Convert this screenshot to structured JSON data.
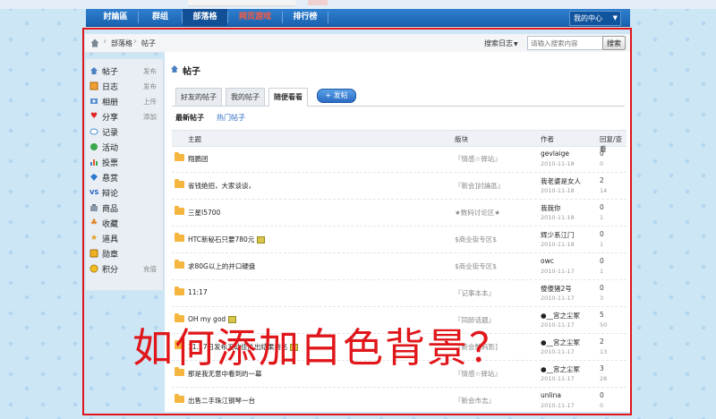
{
  "nav": {
    "items": [
      "討論區",
      "群组",
      "部落格",
      "网页游戏",
      "排行榜"
    ],
    "user_center": "我的中心"
  },
  "breadcrumb": {
    "items": [
      "部落格",
      "帖子"
    ]
  },
  "search": {
    "label": "搜索日志",
    "placeholder": "请输入搜索内容",
    "button": "搜索"
  },
  "sidebar": {
    "items": [
      {
        "label": "帖子",
        "action": "发布",
        "icon": "post-icon"
      },
      {
        "label": "日志",
        "action": "发布",
        "icon": "journal-icon"
      },
      {
        "label": "相册",
        "action": "上传",
        "icon": "album-icon"
      },
      {
        "label": "分享",
        "action": "添加",
        "icon": "heart-icon"
      },
      {
        "label": "记录",
        "action": "",
        "icon": "record-icon"
      },
      {
        "label": "活动",
        "action": "",
        "icon": "activity-icon"
      },
      {
        "label": "投票",
        "action": "",
        "icon": "poll-icon"
      },
      {
        "label": "悬赏",
        "action": "",
        "icon": "reward-icon"
      },
      {
        "label": "辩论",
        "action": "",
        "icon": "debate-icon"
      },
      {
        "label": "商品",
        "action": "",
        "icon": "goods-icon"
      },
      {
        "label": "收藏",
        "action": "",
        "icon": "favorite-icon"
      },
      {
        "label": "道具",
        "action": "",
        "icon": "item-icon"
      },
      {
        "label": "勋章",
        "action": "",
        "icon": "medal-icon"
      },
      {
        "label": "积分",
        "action": "充值",
        "icon": "points-icon"
      }
    ]
  },
  "main": {
    "title": "帖子",
    "tabs": [
      "好友的帖子",
      "我的帖子",
      "随便看看"
    ],
    "post_button": "+ 发帖",
    "subtabs": [
      "最新帖子",
      "热门帖子"
    ],
    "columns": [
      "主题",
      "版块",
      "作者",
      "回复/查看"
    ],
    "rows": [
      {
        "topic": "翔鹏团",
        "board": "『情感☆驿站』",
        "author": "gevlaige",
        "date": "2010-11-18",
        "replies": "0",
        "views": "0",
        "badge": false
      },
      {
        "topic": "省钱绝招，大家谈谈，",
        "board": "『新会]討論區』",
        "author": "我老婆是女人",
        "date": "2010-11-18",
        "replies": "2",
        "views": "14",
        "badge": false
      },
      {
        "topic": "三星I5700",
        "board": "★数码讨论区★",
        "author": "我我你",
        "date": "2010-11-18",
        "replies": "0",
        "views": "1",
        "badge": false
      },
      {
        "topic": "HTC新秘石只要780元",
        "board": "$商业街专区$",
        "author": "辉少系江门",
        "date": "2010-11-18",
        "replies": "0",
        "views": "1",
        "badge": true
      },
      {
        "topic": "求80G以上的并口硬盘",
        "board": "$商业街专区$",
        "author": "owc",
        "date": "2010-11-17",
        "replies": "0",
        "views": "1",
        "badge": false
      },
      {
        "topic": "11:17",
        "board": "『记事本本』",
        "author": "傻傻猪2号",
        "date": "2010-11-17",
        "replies": "0",
        "views": "3",
        "badge": false
      },
      {
        "topic": "OH my god",
        "board": "『同龄话题』",
        "author": "●__宫之尘冢",
        "date": "2010-11-17",
        "replies": "5",
        "views": "50",
        "badge": true
      },
      {
        "topic": "11.17日发布五动佳片出结果前名",
        "board": "『新会数码影]",
        "author": "●__宫之尘冢",
        "date": "2010-11-17",
        "replies": "2",
        "views": "13",
        "badge": true
      },
      {
        "topic": "那是我无意中看到的一幕",
        "board": "『情感☆驿站』",
        "author": "●__宫之尘冢",
        "date": "2010-11-17",
        "replies": "3",
        "views": "28",
        "badge": false
      },
      {
        "topic": "出售二手珠江钢琴一台",
        "board": "『新会市志』",
        "author": "unlina",
        "date": "2010-11-17",
        "replies": "0",
        "views": "0",
        "badge": false
      }
    ]
  },
  "overlay_text": "如何添加白色背景？",
  "colors": {
    "nav_blue": "#1a62b0",
    "highlight_red": "#e0161a",
    "game_red": "#ff5a3c",
    "sidebar_bg": "#e8eef4"
  }
}
